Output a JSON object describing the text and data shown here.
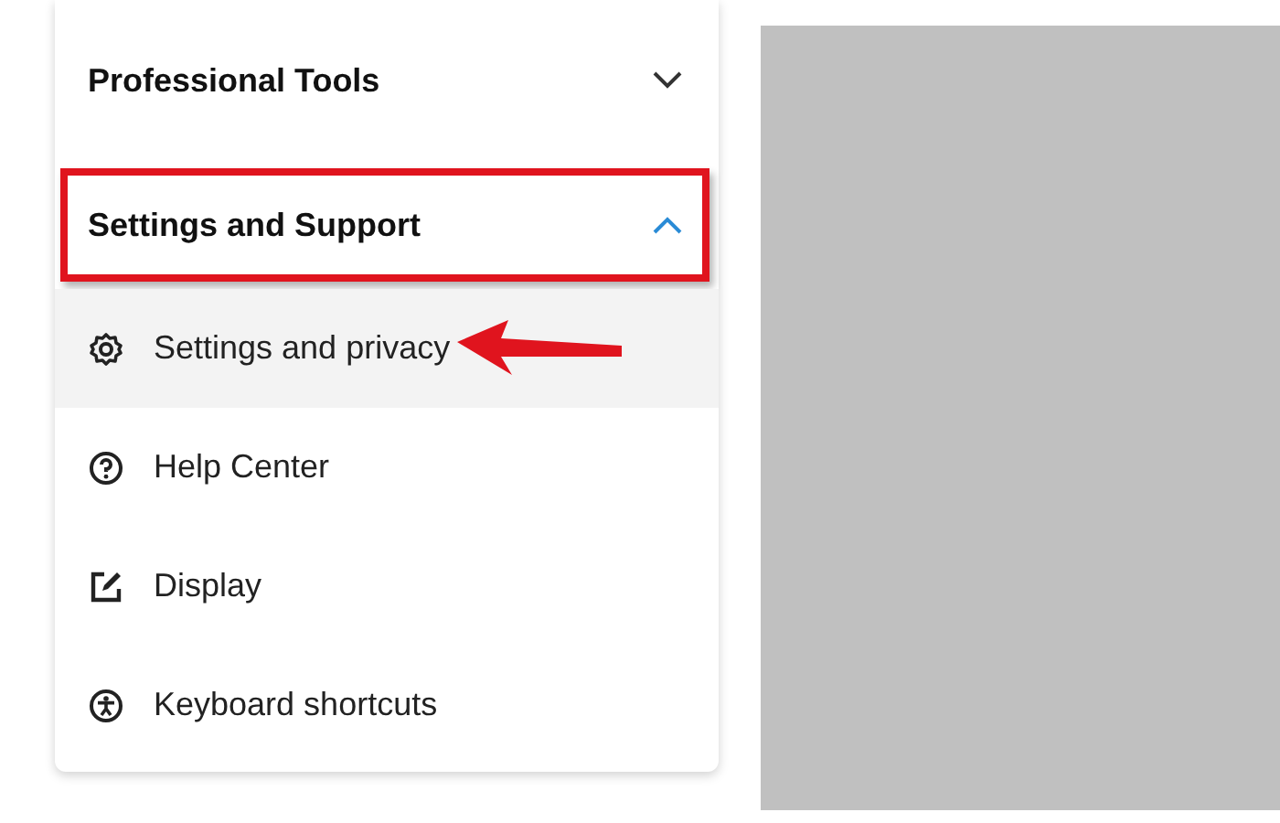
{
  "menu": {
    "sections": [
      {
        "title": "Professional Tools",
        "expanded": false,
        "highlighted": false
      },
      {
        "title": "Settings and Support",
        "expanded": true,
        "highlighted": true,
        "items": [
          {
            "label": "Settings and privacy",
            "hovered": true,
            "pointed": true
          },
          {
            "label": "Help Center",
            "hovered": false,
            "pointed": false
          },
          {
            "label": "Display",
            "hovered": false,
            "pointed": false
          },
          {
            "label": "Keyboard shortcuts",
            "hovered": false,
            "pointed": false
          }
        ]
      }
    ]
  },
  "preview": {
    "kind": "placeholder"
  }
}
